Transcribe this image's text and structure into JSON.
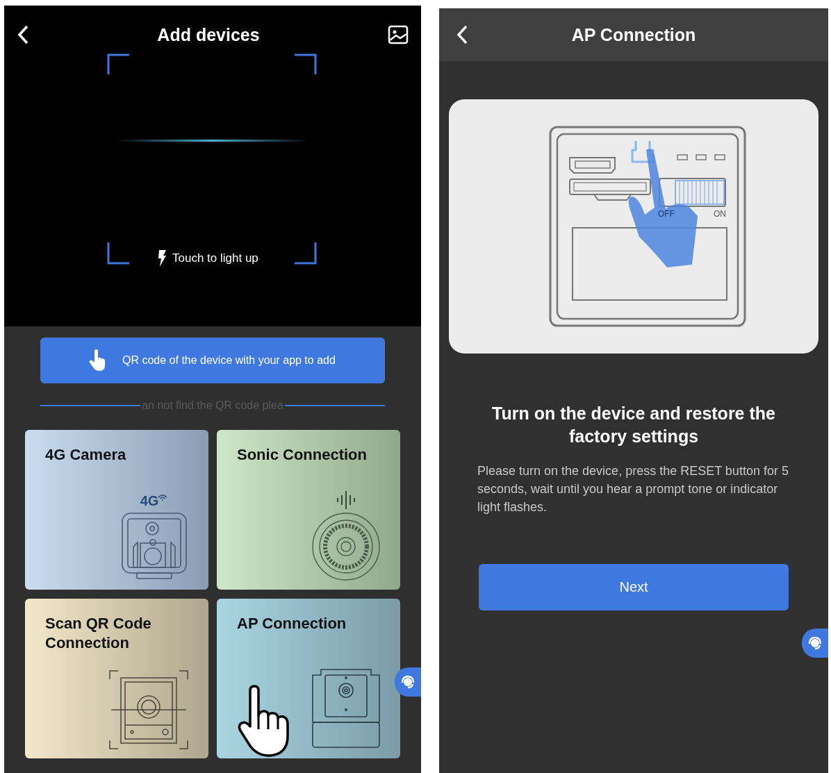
{
  "scan_screen": {
    "title": "Add devices",
    "flash_hint": "Touch to light up",
    "scan_button": "QR code of the device with your app to add",
    "divider_hint": "an not find the QR code plea",
    "cards": [
      {
        "kind": "cellular",
        "title": "4G Camera",
        "badge": "4G"
      },
      {
        "kind": "sonic",
        "title": "Sonic Connection"
      },
      {
        "kind": "qr",
        "title": "Scan QR Code Connection"
      },
      {
        "kind": "ap",
        "title": "AP Connection"
      }
    ]
  },
  "ap_screen": {
    "title": "AP Connection",
    "switch_labels": [
      "OFF",
      "ON"
    ],
    "heading": "Turn on the device and restore the factory settings",
    "instructions": "Please turn on the device, press the RESET button for 5 seconds, wait until you hear a prompt tone or indicator light flashes.",
    "next_button": "Next"
  }
}
